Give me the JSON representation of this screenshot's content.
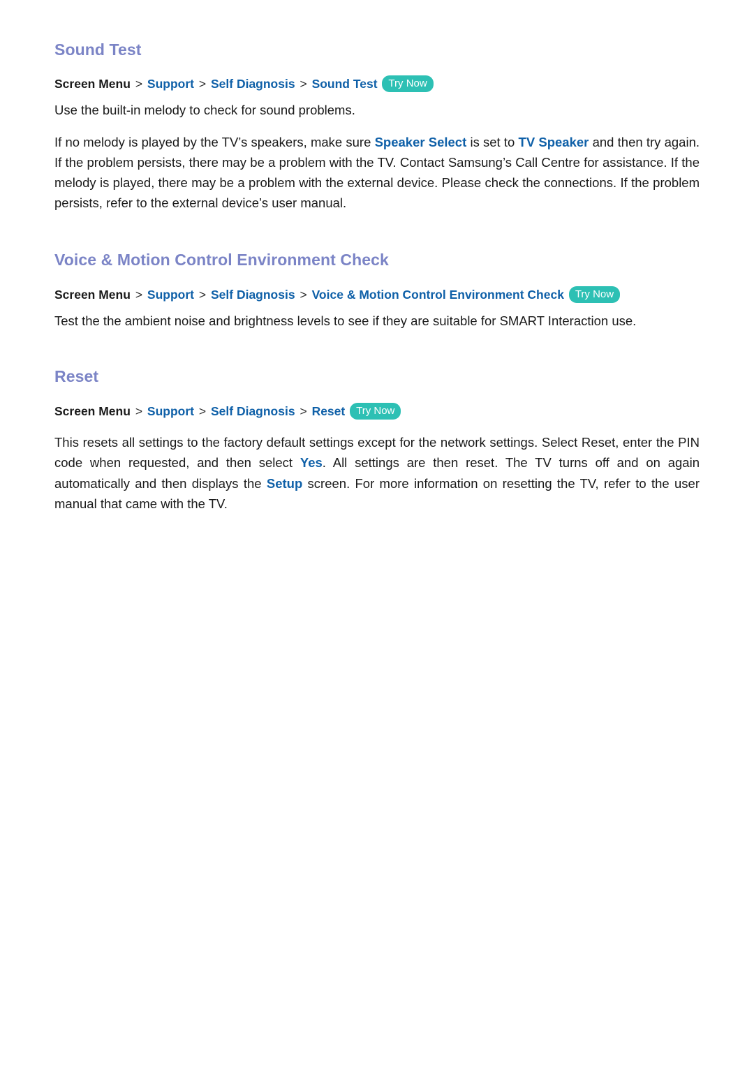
{
  "document": {
    "background_color": "#ffffff",
    "heading_color": "#7b84c6",
    "link_color": "#0f60a8",
    "badge_color": "#2dc0b4",
    "badge_text_color": "#ffffff",
    "body_color": "#1a1a1a"
  },
  "sections": [
    {
      "id": "sound-test",
      "heading": "Sound Test",
      "breadcrumb": {
        "root": "Screen Menu",
        "separator": ">",
        "links": [
          "Support",
          "Self Diagnosis",
          "Sound Test"
        ],
        "badge": "Try Now"
      },
      "paragraph1": "Use the built-in melody to check for sound problems.",
      "paragraph2": {
        "part1": "If no melody is played by the TV’s speakers, make sure ",
        "highlight1": "Speaker Select",
        "part2": " is set to ",
        "highlight2": "TV Speaker",
        "part3": " and then try again. If the problem persists, there may be a problem with the TV. Contact Samsung’s Call Centre for assistance. If the melody is played, there may be a problem with the external device. Please check the connections. If the problem persists, refer to the external device’s user manual."
      }
    },
    {
      "id": "voice-motion-control-environment-check",
      "heading": "Voice & Motion Control Environment Check",
      "breadcrumb": {
        "root": "Screen Menu",
        "separator": ">",
        "links": [
          "Support",
          "Self Diagnosis",
          "Voice & Motion Control Environment Check"
        ],
        "badge": "Try Now"
      },
      "paragraph1": "Test the the ambient noise and brightness levels to see if they are suitable for SMART Interaction use."
    },
    {
      "id": "reset",
      "heading": "Reset",
      "breadcrumb": {
        "root": "Screen Menu",
        "separator": ">",
        "links": [
          "Support",
          "Self Diagnosis",
          "Reset"
        ],
        "badge": "Try Now"
      },
      "paragraph1": {
        "part1": "This resets all settings to the factory default settings except for the network settings. Select Reset, enter the PIN code when requested, and then select ",
        "highlight1": "Yes",
        "part2": ". All settings are then reset. The TV turns off and on again automatically and then displays the ",
        "highlight2": "Setup",
        "part3": " screen. For more information on resetting the TV, refer to the user manual that came with the TV."
      }
    }
  ]
}
